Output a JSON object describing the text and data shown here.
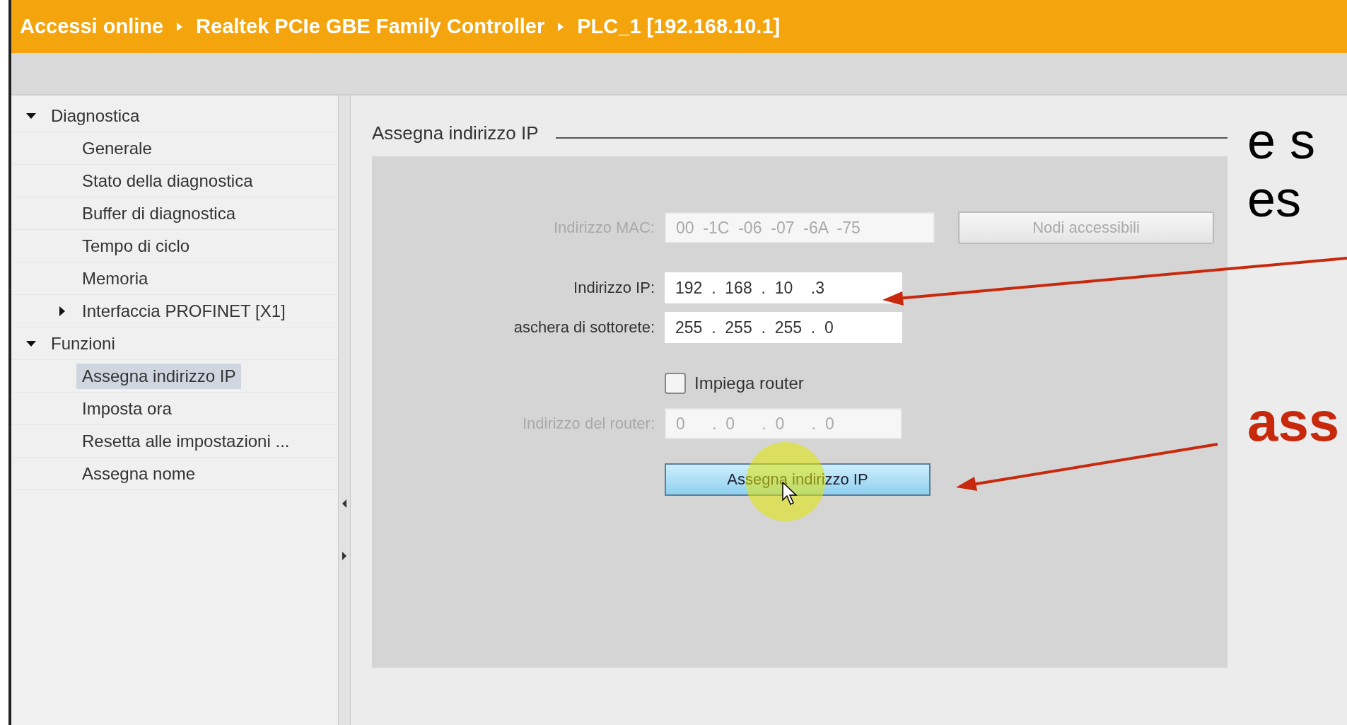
{
  "breadcrumb": [
    "Accessi online",
    "Realtek PCIe GBE Family Controller",
    "PLC_1 [192.168.10.1]"
  ],
  "tree": [
    {
      "label": "Diagnostica",
      "expanded": true,
      "selected": false,
      "children": [
        {
          "label": "Generale",
          "selected": false
        },
        {
          "label": "Stato della diagnostica",
          "selected": false
        },
        {
          "label": "Buffer di diagnostica",
          "selected": false
        },
        {
          "label": "Tempo di ciclo",
          "selected": false
        },
        {
          "label": "Memoria",
          "selected": false
        },
        {
          "label": "Interfaccia PROFINET [X1]",
          "expanded": false,
          "selected": false
        }
      ]
    },
    {
      "label": "Funzioni",
      "expanded": true,
      "selected": false,
      "children": [
        {
          "label": "Assegna indirizzo IP",
          "selected": true
        },
        {
          "label": "Imposta ora",
          "selected": false
        },
        {
          "label": "Resetta alle impostazioni ...",
          "selected": false
        },
        {
          "label": "Assegna nome",
          "selected": false
        }
      ]
    }
  ],
  "section_title": "Assegna indirizzo IP",
  "fields": [
    {
      "label": "Indirizzo MAC:",
      "value": "00  -1C  -06  -07  -6A  -75",
      "disabled": true,
      "button": {
        "label": "Nodi accessibili",
        "disabled": true
      }
    },
    {
      "label": "Indirizzo IP:",
      "value": "192  .  168  .  10    .3",
      "disabled": false
    },
    {
      "label": "aschera di sottorete:",
      "value": "255  .  255  .  255  .  0",
      "disabled": false
    }
  ],
  "router_checkbox": {
    "label": "Impiega router",
    "checked": false
  },
  "router_field": {
    "label": "Indirizzo del router:",
    "value": "0      .  0      .  0      .  0",
    "disabled": true
  },
  "assign_button": {
    "label": "Assegna indirizzo IP"
  },
  "annotations": [
    {
      "text": "e s",
      "kind": "plain"
    },
    {
      "text": "es",
      "kind": "plain"
    },
    {
      "text": "ass",
      "kind": "emphasis"
    }
  ]
}
